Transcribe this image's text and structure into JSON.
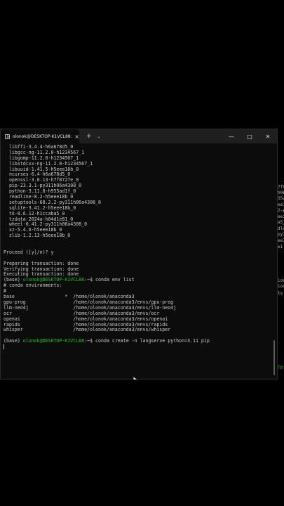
{
  "window": {
    "tab_title": "olonok@DESKTOP-K1VCL88: ~",
    "tab_close": "×",
    "new_tab": "+",
    "dropdown": "⌄",
    "minimize": "—",
    "maximize": "□",
    "close": "✕"
  },
  "terminal": {
    "lines": [
      "  libffi-3.4.4-h6a678d5_0",
      "  libgcc-ng-11.2.0-h1234567_1",
      "  libgomp-11.2.0-h1234567_1",
      "  libstdcxx-ng-11.2.0-h1234567_1",
      "  libuuid-1.41.5-h5eee18b_0",
      "  ncurses-6.4-h6a678d5_0",
      "  openssl-3.0.13-h7f8727e_0",
      "  pip-23.3.1-py311h06a4308_0",
      "  python-3.11.8-h955ad1f_0",
      "  readline-8.2-h5eee18b_0",
      "  setuptools-68.2.2-py311h06a4308_0",
      "  sqlite-3.41.2-h5eee18b_0",
      "  tk-8.6.12-h1ccaba5_0",
      "  tzdata-2024a-h04d1e81_0",
      "  wheel-0.41.2-py311h06a4308_0",
      "  xz-5.4.6-h5eee18b_0",
      "  zlib-1.2.13-h5eee18b_0",
      "",
      "",
      "Proceed ([y]/n)? y",
      "",
      "Preparing transaction: done",
      "Verifying transaction: done",
      "Executing transaction: done"
    ],
    "prompt1": {
      "base": "(base) ",
      "user": "olonok@DESKTOP-K1VCL88",
      "path": ":~$ ",
      "cmd": "conda env list"
    },
    "env_lines": [
      "# conda environments:",
      "#",
      "base                  *  /home/olonok/anaconda3",
      "gpu-prog                 /home/olonok/anaconda3/envs/gpu-prog",
      "llm-neo4j                /home/olonok/anaconda3/envs/llm-neo4j",
      "ocr                      /home/olonok/anaconda3/envs/ocr",
      "openai                   /home/olonok/anaconda3/envs/openai",
      "rapids                   /home/olonok/anaconda3/envs/rapids",
      "whisper                  /home/olonok/anaconda3/envs/whisper",
      ""
    ],
    "prompt2": {
      "base": "(base) ",
      "user": "olonok@DESKTOP-K1VCL88",
      "path": ":~$ ",
      "cmd": "conda create -n langserve python=3.11 pip"
    }
  },
  "right_strip": [
    {
      "text": "7f8",
      "green": false
    },
    {
      "text": "h06",
      "green": false
    },
    {
      "text": "55a",
      "green": false
    },
    {
      "text": "ee1",
      "green": false
    },
    {
      "text": "2-p",
      "green": false
    },
    {
      "text": "ee1",
      "green": false
    },
    {
      "text": "a5_",
      "green": false
    },
    {
      "text": "dle",
      "green": false
    },
    {
      "text": "py3",
      "green": false
    },
    {
      "text": "ee1",
      "green": false
    },
    {
      "text": "e1",
      "green": false
    },
    {
      "text": "ion",
      "green": false
    },
    {
      "text": "ion",
      "green": false
    },
    {
      "text": "ts",
      "green": false
    },
    {
      "text": "TO",
      "green": true
    },
    {
      "text": "TO",
      "green": true
    }
  ],
  "colors": {
    "prompt_green": "#16c60c",
    "text": "#cccccc",
    "background": "#0c0c0c"
  }
}
